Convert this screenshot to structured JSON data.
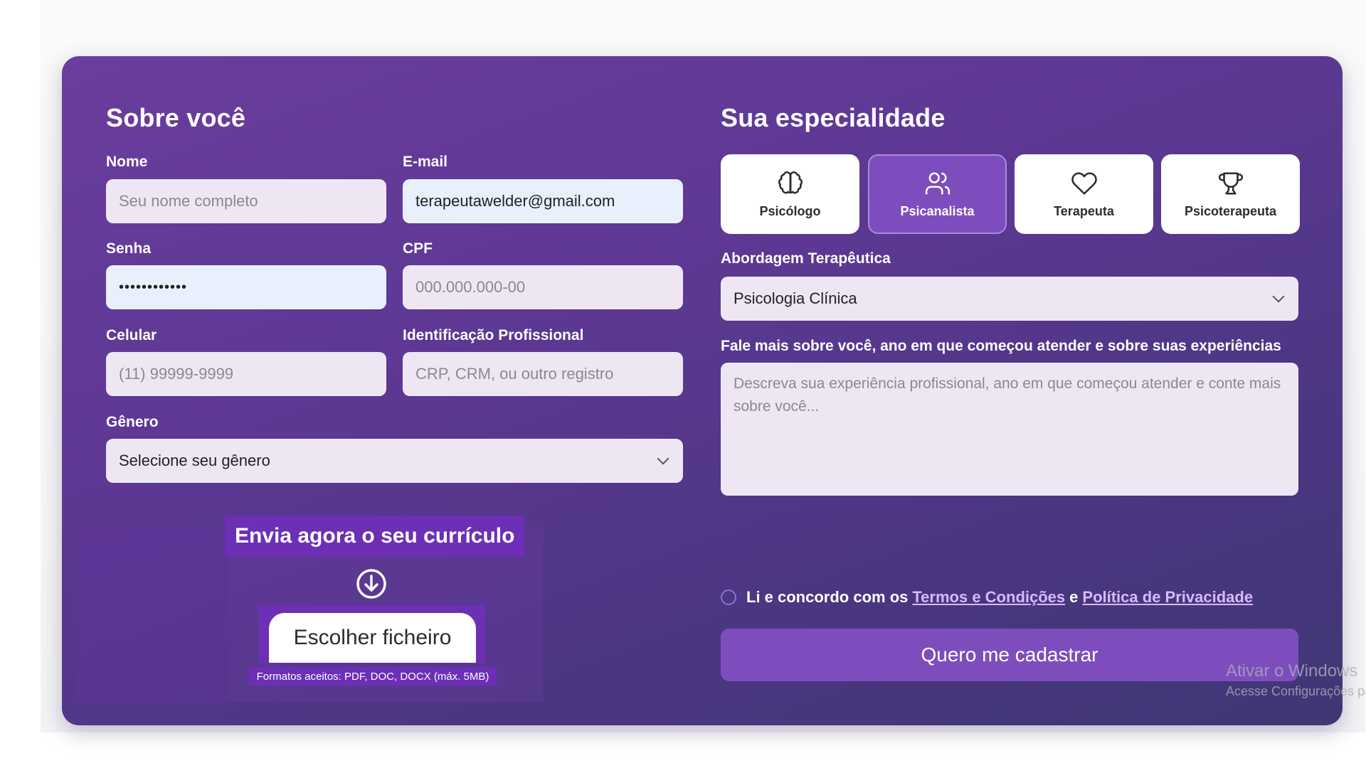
{
  "about": {
    "title": "Sobre você",
    "name": {
      "label": "Nome",
      "placeholder": "Seu nome completo",
      "value": ""
    },
    "email": {
      "label": "E-mail",
      "value": "terapeutawelder@gmail.com"
    },
    "password": {
      "label": "Senha",
      "value": "••••••••••••"
    },
    "cpf": {
      "label": "CPF",
      "placeholder": "000.000.000-00",
      "value": ""
    },
    "phone": {
      "label": "Celular",
      "placeholder": "(11) 99999-9999",
      "value": ""
    },
    "prof_id": {
      "label": "Identificação Profissional",
      "placeholder": "CRP, CRM, ou outro registro",
      "value": ""
    },
    "gender": {
      "label": "Gênero",
      "selected": "Selecione seu gênero"
    }
  },
  "upload": {
    "title": "Envia agora o seu currículo",
    "button_label": "Escolher ficheiro",
    "formats_note": "Formatos aceitos: PDF, DOC, DOCX (máx. 5MB)"
  },
  "specialty": {
    "title": "Sua especialidade",
    "options": [
      {
        "label": "Psicólogo",
        "icon": "brain-icon",
        "selected": false
      },
      {
        "label": "Psicanalista",
        "icon": "users-icon",
        "selected": true
      },
      {
        "label": "Terapeuta",
        "icon": "heart-icon",
        "selected": false
      },
      {
        "label": "Psicoterapeuta",
        "icon": "trophy-icon",
        "selected": false
      }
    ],
    "approach": {
      "label": "Abordagem Terapêutica",
      "selected": "Psicologia Clínica"
    },
    "about_more": {
      "label": "Fale mais sobre você, ano em que começou atender e sobre suas experiências",
      "placeholder": "Descreva sua experiência profissional, ano em que começou atender e conte mais sobre você..."
    }
  },
  "terms": {
    "prefix": "Li e concordo com os",
    "terms_link": "Termos e Condições",
    "conjunction": "e",
    "privacy_link": "Política de Privacidade",
    "checked": false
  },
  "submit_label": "Quero me cadastrar",
  "watermark": {
    "line1": "Ativar o Windows",
    "line2": "Acesse Configurações pa"
  },
  "colors": {
    "card_gradient_start": "#6b3d9e",
    "card_gradient_end": "#3f3774",
    "accent": "#7e4dbd",
    "upload_highlight": "#6d2fb6",
    "input_bg": "#efe6f4",
    "autofill_bg": "#e8f0fe",
    "link": "#d9b8ff"
  }
}
